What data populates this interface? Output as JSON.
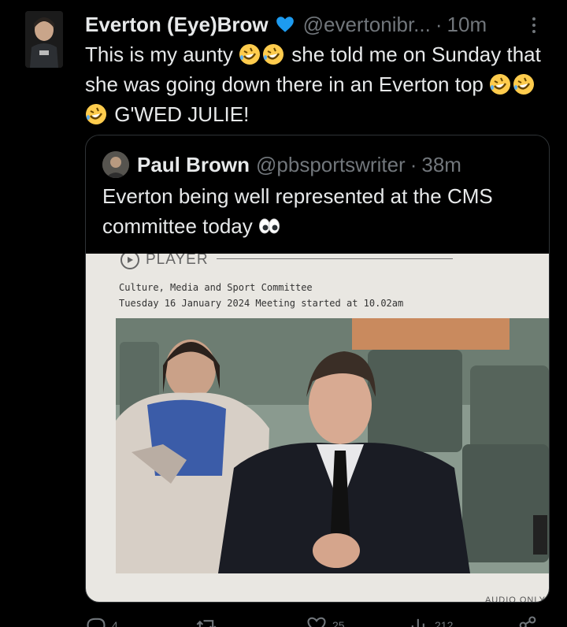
{
  "tweet": {
    "display_name": "Everton (Eye)Brow",
    "handle": "@evertonibr...",
    "separator": "·",
    "time": "10m",
    "text_part1": "This is my aunty ",
    "text_part2": " she told me on Sunday that she was going down there in an Everton top ",
    "text_part3": " G'WED JULIE!"
  },
  "quote": {
    "display_name": "Paul Brown",
    "handle": "@pbsportswriter",
    "separator": "·",
    "time": "38m",
    "text": "Everton being well represented at the CMS committee today ",
    "media": {
      "player_label": "PLAYER",
      "committee": "Culture, Media and Sport Committee",
      "meeting": "Tuesday 16 January 2024 Meeting started at 10.02am",
      "audio_only": "AUDIO ONLY"
    }
  },
  "actions": {
    "reply_count": "4",
    "retweet_count": "",
    "like_count": "25",
    "views_count": "212"
  },
  "colors": {
    "background": "#000000",
    "text": "#e7e9ea",
    "muted": "#71767b",
    "verified": "#1d9bf0",
    "border": "#2f3336"
  }
}
